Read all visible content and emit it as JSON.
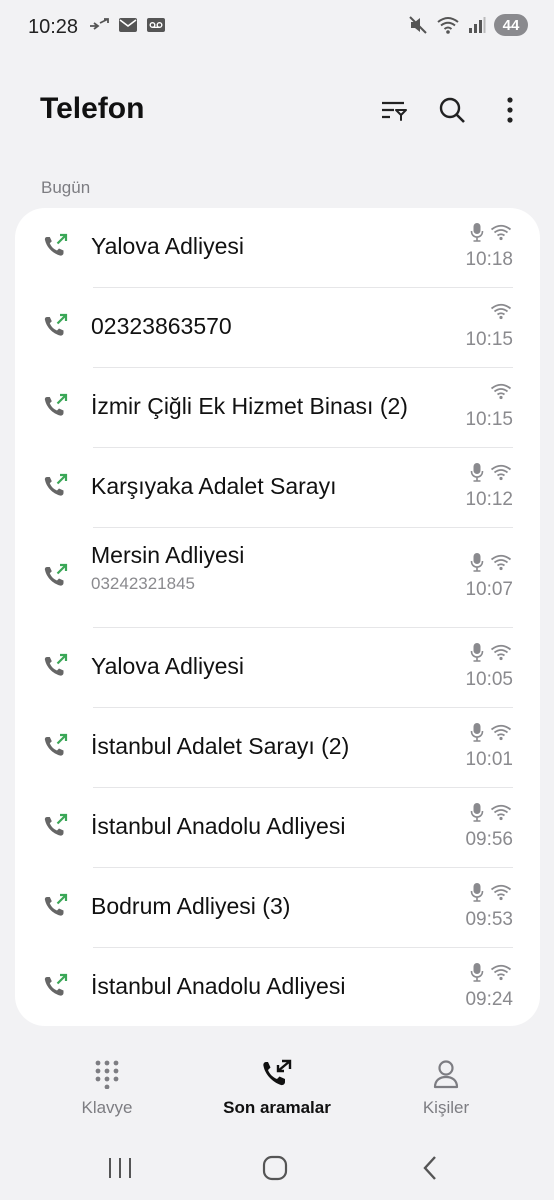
{
  "status_bar": {
    "time": "10:28",
    "battery": "44"
  },
  "app": {
    "title": "Telefon"
  },
  "section": {
    "label": "Bugün"
  },
  "calls": [
    {
      "name": "Yalova Adliyesi",
      "number": "",
      "time": "10:18",
      "mic": true
    },
    {
      "name": "02323863570",
      "number": "",
      "time": "10:15",
      "mic": false
    },
    {
      "name": "İzmir Çiğli Ek Hizmet Binası (2)",
      "number": "",
      "time": "10:15",
      "mic": false
    },
    {
      "name": "Karşıyaka Adalet Sarayı",
      "number": "",
      "time": "10:12",
      "mic": true
    },
    {
      "name": "Mersin Adliyesi",
      "number": "03242321845",
      "time": "10:07",
      "mic": true
    },
    {
      "name": "Yalova Adliyesi",
      "number": "",
      "time": "10:05",
      "mic": true
    },
    {
      "name": "İstanbul Adalet Sarayı (2)",
      "number": "",
      "time": "10:01",
      "mic": true
    },
    {
      "name": "İstanbul Anadolu Adliyesi",
      "number": "",
      "time": "09:56",
      "mic": true
    },
    {
      "name": "Bodrum Adliyesi (3)",
      "number": "",
      "time": "09:53",
      "mic": true
    },
    {
      "name": "İstanbul Anadolu Adliyesi",
      "number": "",
      "time": "09:24",
      "mic": true
    }
  ],
  "bottom_nav": {
    "keypad": "Klavye",
    "recents": "Son aramalar",
    "contacts": "Kişiler"
  },
  "colors": {
    "outgoing_call": "#3aa757",
    "icon_gray": "#8a8a8e"
  }
}
